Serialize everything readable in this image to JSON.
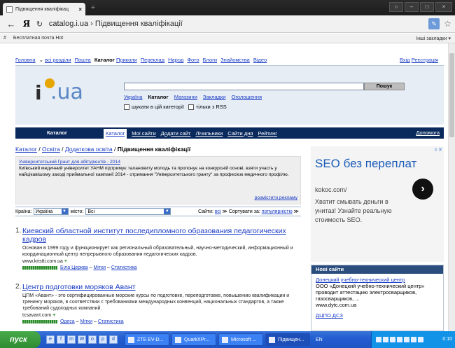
{
  "browser": {
    "tab_title": "Підвищення кваліфікац",
    "tab_close": "×",
    "new_tab": "+",
    "window_buttons": [
      "○",
      "–",
      "□",
      "×"
    ],
    "back": "←",
    "yandex": "Я",
    "reload": "↻",
    "url_host": "catalog.i.ua",
    "url_sep": " › ",
    "url_path": "Підвищення кваліфікації",
    "star": "☆",
    "bookmarks": {
      "hash": "#",
      "item": "Бесплатная почта Hot",
      "other": "Інші закладки ▾"
    }
  },
  "topmenu": {
    "items": [
      "Головна",
      "всі розділи",
      "Пошта",
      "Каталог",
      "Приколи",
      "Переклад",
      "Народ",
      "Фото",
      "Блоги",
      "Знайомства",
      "Відео"
    ],
    "chevron": "⌄",
    "auth": [
      "Вхід",
      "Реєстрація"
    ]
  },
  "search": {
    "button": "Пошук",
    "tabs": [
      "Україна",
      "Каталог",
      "Магазини",
      "Закладки",
      "Оголошення"
    ],
    "opt1": "шукати в цій категорії",
    "opt2": "тільки з RSS"
  },
  "catbar": {
    "label": "Каталог",
    "items": [
      "Каталог",
      "Мої сайти",
      "Додати сайт",
      "Лічильники",
      "Сайти дня",
      "Рейтинг"
    ],
    "help": "Допомога"
  },
  "breadcrumb": {
    "items": [
      "Каталог",
      "Освіта",
      "Додаткова освіта"
    ],
    "sep": " / ",
    "current": "Підвищення кваліфікації"
  },
  "grant": {
    "title": "Університетський Грант для абітурієнтів - 2014",
    "text": "Київський медичний університет УАНМ підтримує талановиту молодь та пропонує на конкурсній основі, взяти участь у найцікавішому заході приймальної кампанії 2014 - отримання \"Університетського гранту\" за професією медичного профілю.",
    "more": "розмістити рекламу"
  },
  "filters": {
    "country_label": "Країна:",
    "country_value": "Україна",
    "city_label": "місто:",
    "city_value": "Всі",
    "sites_label": "Сайти:",
    "sites_value": "всі",
    "sort_label": "Сортувати за:",
    "sort_value": "популярністю"
  },
  "results": [
    {
      "num": "1.",
      "title": "Киевский областной институт последипломного образования педагогических кадров",
      "desc": "Основан в 1999 году и функционирует как региональный образовательный, научно-методический, информационный и координационный центр непрерывного образования педагогических кадров.",
      "site": "www.kristti.com.ua",
      "city": "Біла Церква",
      "tags": "Мітки",
      "stats": "Статистика"
    },
    {
      "num": "2.",
      "title": "Центр подготовки моряков Авант",
      "desc": "ЦПМ «Авант» - это сертифицированные морские курсы по подготовке, переподготовке, повышению квалификации и тренингу моряков, в соответствии с требованиями международных конвенций, национальных стандартов, а также требований судоходных компаний.",
      "site": "tcsavant.com",
      "city": "Одеса",
      "tags": "Мітки",
      "stats": "Статистика"
    }
  ],
  "ad": {
    "close": "◊ ✕",
    "headline": "SEO без переплат",
    "domain": "kokoc.com/",
    "text": "Хватит смывать деньги в унитаз! Узнайте реальную стоимость SEO.",
    "go": "›"
  },
  "new_sites": {
    "header": "Нові сайти",
    "items": [
      {
        "title": "Донецкий учебно-технический центр",
        "text": "ООО «Донецкий учебно-технический центр» проводит аттестацию электросварщиков, газосварщиков, ...",
        "url": "www.dytc.com.ua"
      },
      {
        "title": "ДЦПО ДСЗ",
        "text": "",
        "url": ""
      }
    ]
  },
  "taskbar": {
    "start": "пуск",
    "quicklaunch": [
      "e",
      "f",
      "m",
      "W",
      "o",
      "p",
      "d"
    ],
    "tasks": [
      "ZTE EV-D...",
      "QuarkXPr...",
      "Microsoft ...",
      "Підвищен..."
    ],
    "lang": "EN",
    "clock": "0:10"
  }
}
